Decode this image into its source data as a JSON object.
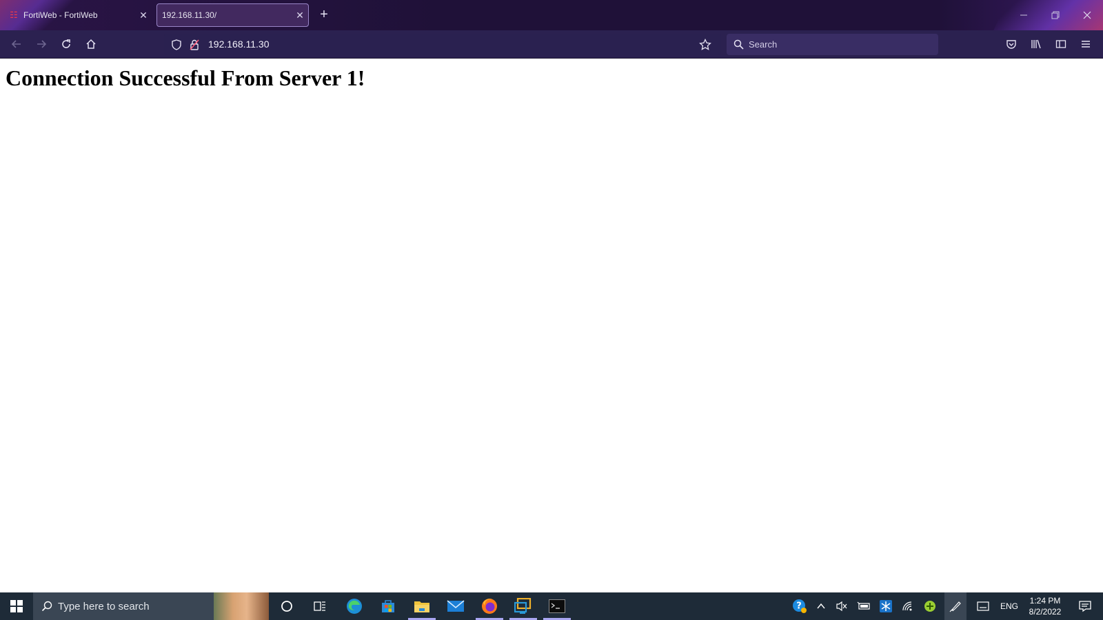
{
  "browser": {
    "tabs": [
      {
        "title": "FortiWeb - FortiWeb",
        "favicon": "fortinet-logo-icon",
        "active": false
      },
      {
        "title": "192.168.11.30/",
        "favicon": "",
        "active": true
      }
    ],
    "url": "192.168.11.30",
    "search_placeholder": "Search",
    "accent_color": "#2b2150"
  },
  "page": {
    "heading": "Connection Successful From Server 1!"
  },
  "taskbar": {
    "search_placeholder": "Type here to search",
    "apps": [
      "edge-icon",
      "store-icon",
      "file-explorer-icon",
      "mail-icon",
      "firefox-icon",
      "remote-desktop-icon",
      "terminal-icon"
    ],
    "language": "ENG",
    "time": "1:24 PM",
    "date": "8/2/2022"
  }
}
